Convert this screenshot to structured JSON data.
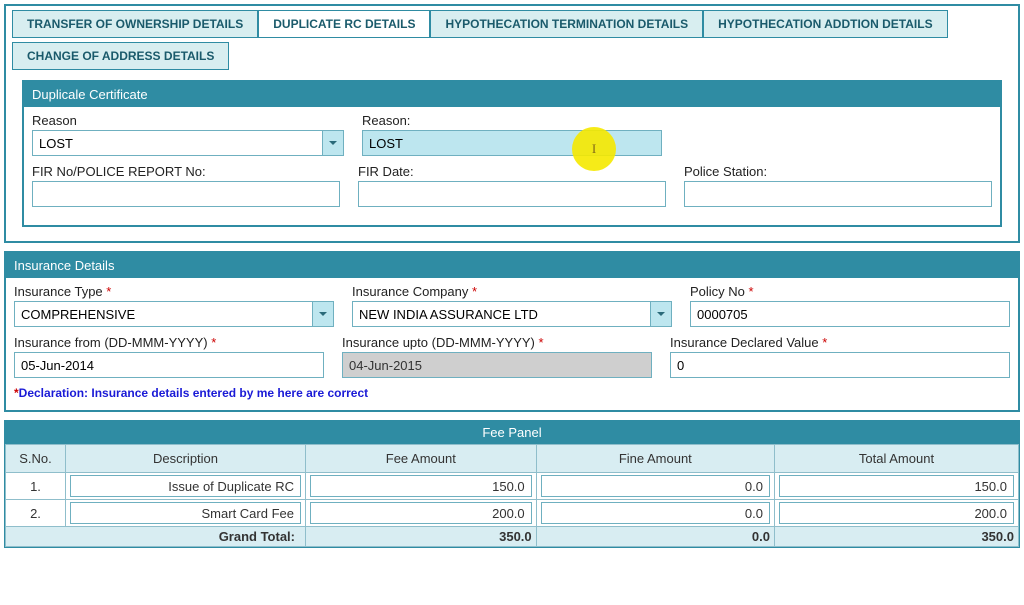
{
  "tabs": {
    "transfer": "TRANSFER OF OWNERSHIP DETAILS",
    "duplicate": "DUPLICATE RC DETAILS",
    "hypo_term": "HYPOTHECATION TERMINATION DETAILS",
    "hypo_add": "HYPOTHECATION ADDTION DETAILS",
    "change_addr": "CHANGE OF ADDRESS DETAILS"
  },
  "duplicate_cert": {
    "header": "Duplicale Certificate",
    "reason_label": "Reason",
    "reason_select_value": "LOST",
    "reason2_label": "Reason:",
    "reason2_value": "LOST",
    "fir_no_label": "FIR No/POLICE REPORT No:",
    "fir_no_value": "",
    "fir_date_label": "FIR Date:",
    "fir_date_value": "",
    "police_station_label": "Police Station:",
    "police_station_value": ""
  },
  "insurance": {
    "header": "Insurance Details",
    "type_label": "Insurance Type",
    "type_value": "COMPREHENSIVE",
    "company_label": "Insurance Company",
    "company_value": "NEW INDIA ASSURANCE LTD",
    "policy_label": "Policy No",
    "policy_value": "0000705",
    "from_label": "Insurance from (DD-MMM-YYYY)",
    "from_value": "05-Jun-2014",
    "upto_label": "Insurance upto (DD-MMM-YYYY)",
    "upto_value": "04-Jun-2015",
    "idv_label": "Insurance Declared Value",
    "idv_value": "0",
    "declaration": "Declaration: Insurance details entered by me here are correct"
  },
  "fee": {
    "panel_title": "Fee Panel",
    "columns": {
      "sno": "S.No.",
      "desc": "Description",
      "fee": "Fee Amount",
      "fine": "Fine Amount",
      "total": "Total Amount"
    },
    "rows": [
      {
        "sno": "1.",
        "desc": "Issue of Duplicate RC",
        "fee": "150.0",
        "fine": "0.0",
        "total": "150.0"
      },
      {
        "sno": "2.",
        "desc": "Smart Card Fee",
        "fee": "200.0",
        "fine": "0.0",
        "total": "200.0"
      }
    ],
    "grand_total_label": "Grand Total:",
    "grand_fee": "350.0",
    "grand_fine": "0.0",
    "grand_total": "350.0"
  },
  "required_marker": "*"
}
